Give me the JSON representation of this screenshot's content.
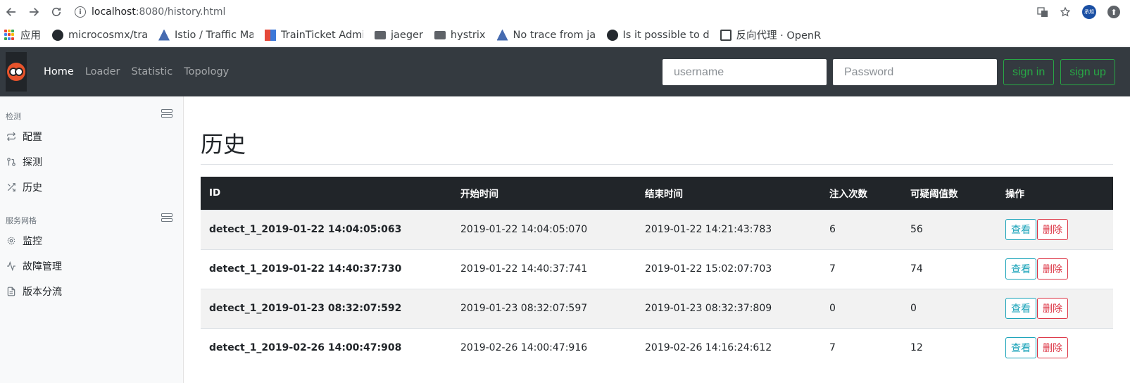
{
  "browser": {
    "url_host": "localhost",
    "url_path": ":8080/history.html",
    "profile_label": "承旭",
    "bookmarks": [
      {
        "icon": "apps-grid-icon",
        "label": "应用"
      },
      {
        "icon": "github-icon",
        "label": "microcosmx/tra"
      },
      {
        "icon": "istio-icon",
        "label": "Istio / Traffic Ma"
      },
      {
        "icon": "trainticket-icon",
        "label": "TrainTicket Admi"
      },
      {
        "icon": "folder-icon",
        "label": "jaeger"
      },
      {
        "icon": "folder-icon",
        "label": "hystrix"
      },
      {
        "icon": "istio-icon",
        "label": "No trace from ja"
      },
      {
        "icon": "github-icon",
        "label": "Is it possible to d"
      },
      {
        "icon": "book-icon",
        "label": "反向代理 · OpenR"
      }
    ]
  },
  "navbar": {
    "links": [
      {
        "label": "Home",
        "active": true
      },
      {
        "label": "Loader",
        "active": false
      },
      {
        "label": "Statistic",
        "active": false
      },
      {
        "label": "Topology",
        "active": false
      }
    ],
    "username_placeholder": "username",
    "password_placeholder": "Password",
    "signin_label": "sign in",
    "signup_label": "sign up"
  },
  "sidebar": {
    "sections": [
      {
        "heading": "检测",
        "items": [
          {
            "icon": "repeat-icon",
            "label": "配置"
          },
          {
            "icon": "git-pull-icon",
            "label": "探测"
          },
          {
            "icon": "shuffle-icon",
            "label": "历史"
          }
        ]
      },
      {
        "heading": "服务网格",
        "items": [
          {
            "icon": "settings-icon",
            "label": "监控"
          },
          {
            "icon": "activity-icon",
            "label": "故障管理"
          },
          {
            "icon": "file-icon",
            "label": "版本分流"
          }
        ]
      }
    ]
  },
  "main": {
    "title": "历史",
    "columns": [
      "ID",
      "开始时间",
      "结束时间",
      "注入次数",
      "可疑阈值数",
      "操作"
    ],
    "rows": [
      {
        "id": "detect_1_2019-01-22 14:04:05:063",
        "start": "2019-01-22 14:04:05:070",
        "end": "2019-01-22 14:21:43:783",
        "injections": "6",
        "suspects": "56"
      },
      {
        "id": "detect_1_2019-01-22 14:40:37:730",
        "start": "2019-01-22 14:40:37:741",
        "end": "2019-01-22 15:02:07:703",
        "injections": "7",
        "suspects": "74"
      },
      {
        "id": "detect_1_2019-01-23 08:32:07:592",
        "start": "2019-01-23 08:32:07:597",
        "end": "2019-01-23 08:32:37:809",
        "injections": "0",
        "suspects": "0"
      },
      {
        "id": "detect_1_2019-02-26 14:00:47:908",
        "start": "2019-02-26 14:00:47:916",
        "end": "2019-02-26 14:16:24:612",
        "injections": "7",
        "suspects": "12"
      }
    ],
    "view_label": "查看",
    "delete_label": "删除"
  },
  "colors": {
    "navbar": "#343a40",
    "success": "#28a745",
    "info": "#17a2b8",
    "danger": "#dc3545",
    "table_head": "#212529"
  }
}
